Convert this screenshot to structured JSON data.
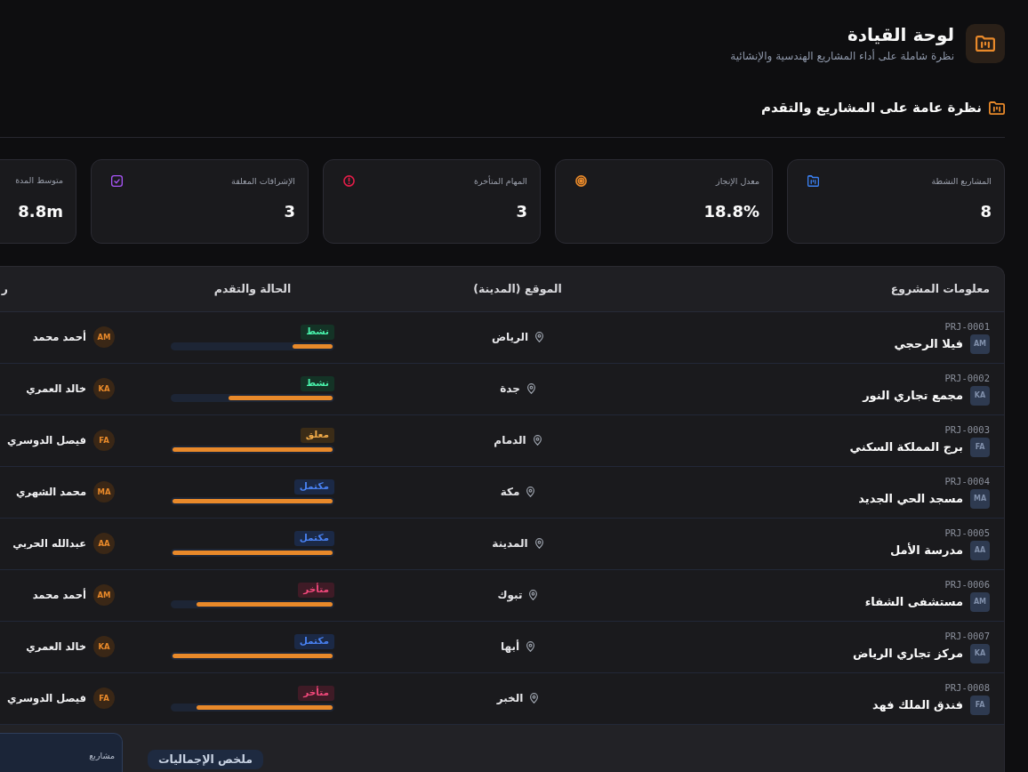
{
  "header": {
    "title": "لوحة القيادة",
    "subtitle": "نظرة شاملة على أداء المشاريع الهندسية والإنشائية"
  },
  "section": {
    "title": "نظرة عامة على المشاريع والتقدم"
  },
  "stats": [
    {
      "label": "المشاريع النشطة",
      "value": "8",
      "kind": "folder",
      "color": "#3b82f6"
    },
    {
      "label": "معدل الإنجاز",
      "value": "18.8%",
      "kind": "target",
      "color": "#e8892a"
    },
    {
      "label": "المهام المتأخرة",
      "value": "3",
      "kind": "alert",
      "color": "#e11d48"
    },
    {
      "label": "الإشرافات المعلقة",
      "value": "3",
      "kind": "check",
      "color": "#a855f7"
    },
    {
      "label": "متوسط المدة",
      "value": "8.8m"
    }
  ],
  "table": {
    "columns": [
      "معلومات المشروع",
      "الموقع (المدينة)",
      "الحالة والتقدم",
      "ر"
    ],
    "rows": [
      {
        "code": "PRJ-0001",
        "initials": "AM",
        "name": "فيلا الرحجي",
        "city": "الرياض",
        "status": {
          "label": "نشط",
          "color": "#143326"
        },
        "level": 0.25,
        "manager": {
          "initials": "AM",
          "name": "أحمد محمد"
        }
      },
      {
        "code": "PRJ-0002",
        "initials": "KA",
        "name": "مجمع تجاري النور",
        "city": "جدة",
        "status": {
          "label": "نشط",
          "color": "#143326"
        },
        "level": 0.65,
        "manager": {
          "initials": "KA",
          "name": "خالد العمري"
        }
      },
      {
        "code": "PRJ-0003",
        "initials": "FA",
        "name": "برج المملكة السكني",
        "city": "الدمام",
        "status": {
          "label": "معلق",
          "color": "#3b2c17"
        },
        "level": 1,
        "manager": {
          "initials": "FA",
          "name": "فيصل الدوسري"
        }
      },
      {
        "code": "PRJ-0004",
        "initials": "MA",
        "name": "مسجد الحي الجديد",
        "city": "مكة",
        "status": {
          "label": "مكتمل",
          "color": "#1b2946"
        },
        "level": 1,
        "manager": {
          "initials": "MA",
          "name": "محمد الشهري"
        }
      },
      {
        "code": "PRJ-0005",
        "initials": "AA",
        "name": "مدرسة الأمل",
        "city": "المدينة",
        "status": {
          "label": "مكتمل",
          "color": "#1b2946"
        },
        "level": 1,
        "manager": {
          "initials": "AA",
          "name": "عبدالله الحربي"
        }
      },
      {
        "code": "PRJ-0006",
        "initials": "AM",
        "name": "مستشفى الشفاء",
        "city": "تبوك",
        "status": {
          "label": "متأخر",
          "color": "#3f1b26"
        },
        "level": 0.85,
        "manager": {
          "initials": "AM",
          "name": "أحمد محمد"
        }
      },
      {
        "code": "PRJ-0007",
        "initials": "KA",
        "name": "مركز تجاري الرياض",
        "city": "أبها",
        "status": {
          "label": "مكتمل",
          "color": "#1b2946"
        },
        "level": 1,
        "manager": {
          "initials": "KA",
          "name": "خالد العمري"
        }
      },
      {
        "code": "PRJ-0008",
        "initials": "FA",
        "name": "فندق الملك فهد",
        "city": "الخبر",
        "status": {
          "label": "متأخر",
          "color": "#3f1b26"
        },
        "level": 0.85,
        "manager": {
          "initials": "FA",
          "name": "فيصل الدوسري"
        }
      }
    ]
  },
  "footer": {
    "stat_card": {
      "label": "مشاريع"
    },
    "heading": "ملخص الإجماليات"
  }
}
